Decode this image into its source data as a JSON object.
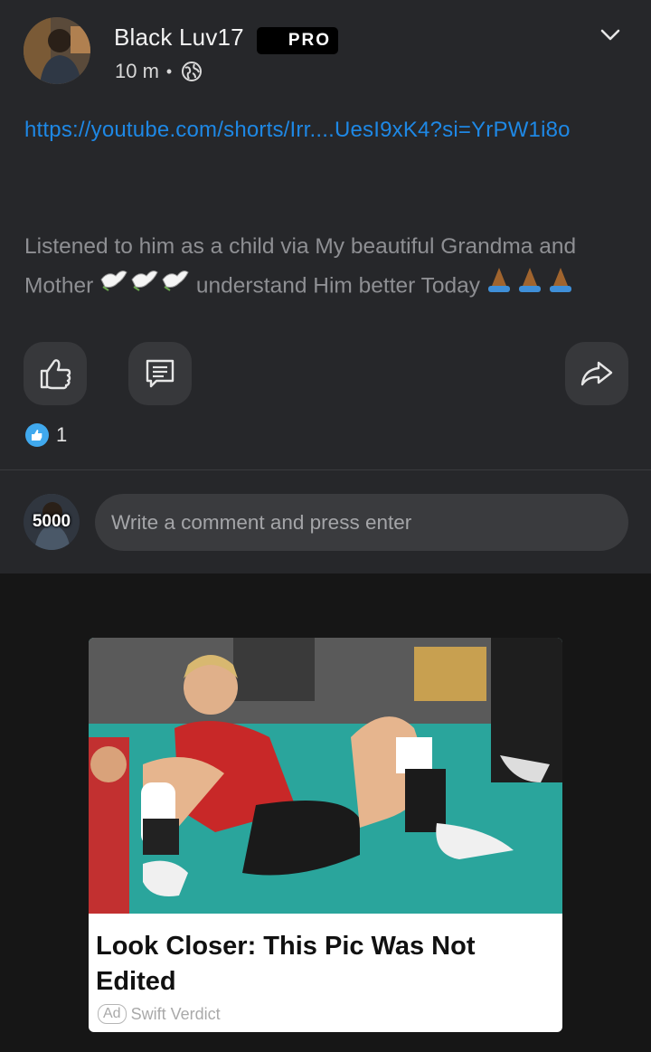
{
  "post": {
    "author": "Black Luv17",
    "badge": "PRO",
    "time": "10 m",
    "separator": "•",
    "privacy_icon": "globe-icon",
    "link": "https://youtube.com/shorts/Irr....UesI9xK4?si=YrPW1i8o",
    "text_before": "Listened to him as a child via My beautiful Grandma and Mother",
    "text_middle": "understand Him better Today",
    "emoji_doves": "🕊🕊🕊",
    "emoji_hands": "🙏🙏🙏",
    "like_count": "1",
    "actions": [
      "thumbs-up-icon",
      "comment-icon",
      "share-icon"
    ]
  },
  "composer": {
    "points": "5000",
    "placeholder": "Write a comment and press enter"
  },
  "ad": {
    "title": "Look Closer: This Pic Was Not Edited",
    "tag": "Ad",
    "source": "Swift Verdict"
  },
  "colors": {
    "post_bg": "#26272a",
    "page_bg": "#161616",
    "link": "#1e88e5",
    "muted_text": "#8e8f93",
    "like_blue": "#40a9ee"
  }
}
